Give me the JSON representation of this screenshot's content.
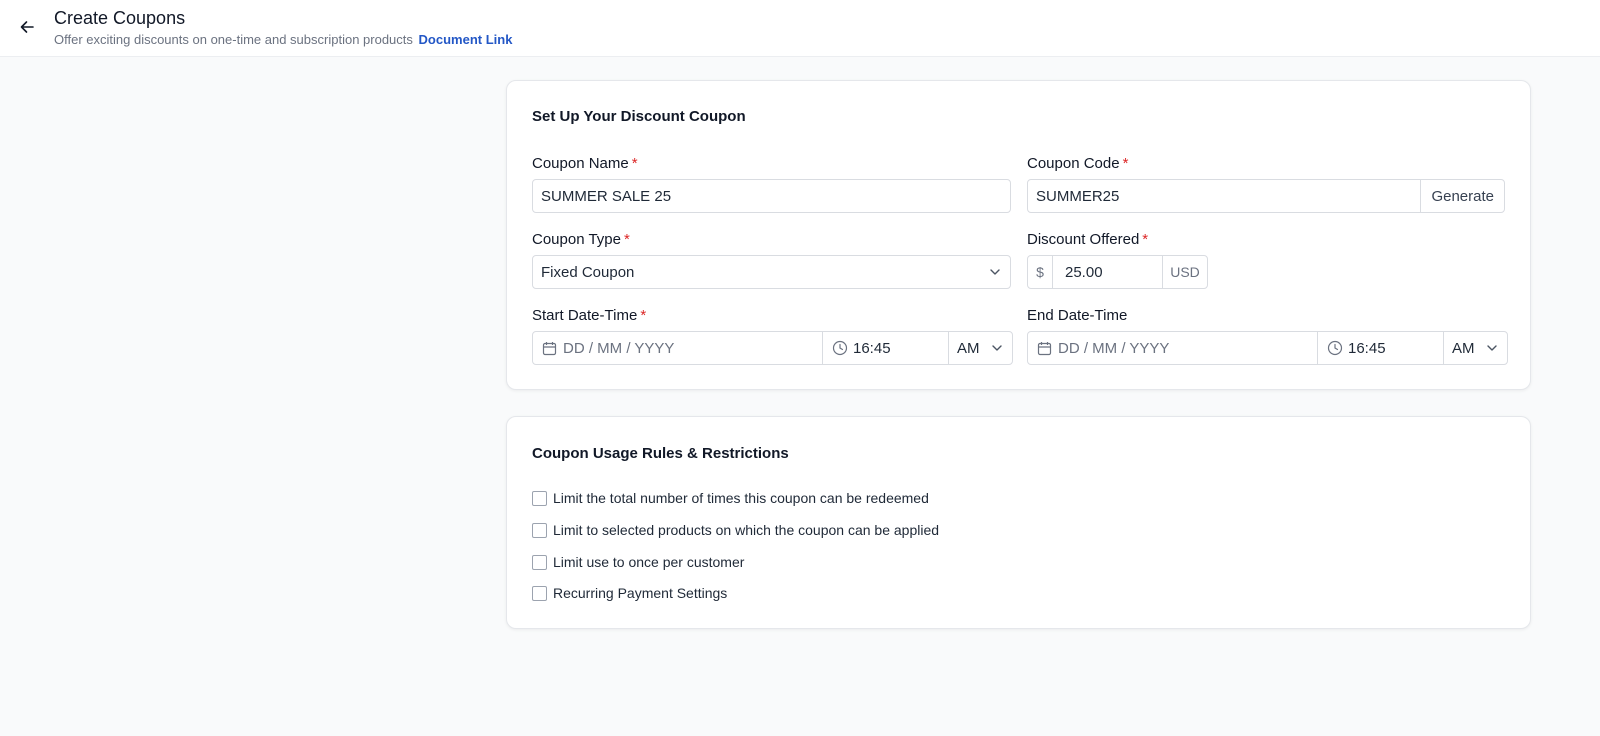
{
  "header": {
    "title": "Create Coupons",
    "subtitle": "Offer exciting discounts on one-time and subscription products",
    "doc_link": "Document Link"
  },
  "setup": {
    "title": "Set Up Your Discount Coupon",
    "coupon_name": {
      "label": "Coupon Name",
      "value": "SUMMER SALE 25"
    },
    "coupon_code": {
      "label": "Coupon Code",
      "value": "SUMMER25",
      "generate_label": "Generate"
    },
    "coupon_type": {
      "label": "Coupon Type",
      "value": "Fixed Coupon"
    },
    "discount": {
      "label": "Discount Offered",
      "prefix": "$",
      "value": "25.00",
      "suffix": "USD"
    },
    "start": {
      "label": "Start Date-Time",
      "date_placeholder": "DD / MM / YYYY",
      "time": "16:45",
      "meridiem": "AM"
    },
    "end": {
      "label": "End Date-Time",
      "date_placeholder": "DD / MM / YYYY",
      "time": "16:45",
      "meridiem": "AM"
    }
  },
  "rules": {
    "title": "Coupon Usage Rules & Restrictions",
    "items": [
      "Limit the total number of times this coupon can be redeemed",
      "Limit to selected products on which the coupon can be applied",
      "Limit use to once per customer",
      "Recurring Payment Settings"
    ]
  },
  "colors": {
    "accent_link": "#2357c6",
    "required": "#dc2626"
  }
}
